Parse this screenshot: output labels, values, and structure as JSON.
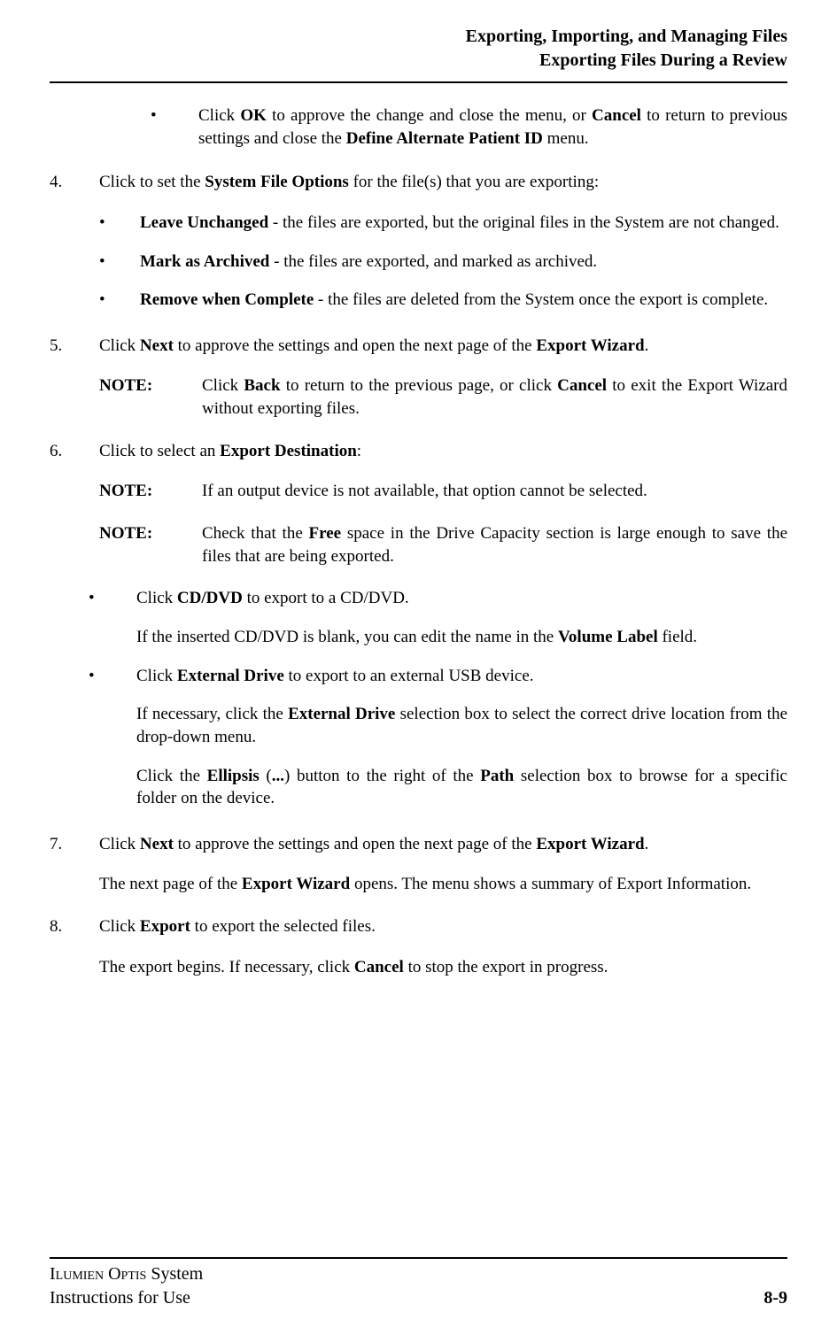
{
  "header": {
    "line1": "Exporting, Importing, and Managing Files",
    "line2": "Exporting Files During a Review"
  },
  "bullet1_pre": "Click ",
  "bullet1_b1": "OK",
  "bullet1_mid1": " to approve the change and close the menu, or ",
  "bullet1_b2": "Cancel",
  "bullet1_mid2": " to return to previous settings and close the ",
  "bullet1_b3": "Define Alternate Patient ID",
  "bullet1_post": " menu.",
  "step4_num": "4.",
  "step4_pre": "Click to set the ",
  "step4_b1": "System File Options",
  "step4_post": " for the file(s) that you are exporting:",
  "step4_opt1_b": "Leave Unchanged",
  "step4_opt1_t": " - the files are exported, but the original files in the System are not changed.",
  "step4_opt2_b": "Mark as Archived",
  "step4_opt2_t": " - the files are exported, and marked as archived.",
  "step4_opt3_b": "Remove when Complete",
  "step4_opt3_t": " - the files are deleted from the System once the export is complete.",
  "step5_num": "5.",
  "step5_pre": "Click ",
  "step5_b1": "Next",
  "step5_mid": " to approve the settings and open the next page of the ",
  "step5_b2": "Export Wizard",
  "step5_post": ".",
  "note_label": "NOTE:",
  "note1_pre": "Click ",
  "note1_b1": "Back",
  "note1_mid": " to return to the previous page, or click ",
  "note1_b2": "Cancel",
  "note1_post": " to exit the Export Wizard without exporting files.",
  "step6_num": "6.",
  "step6_pre": "Click to select an ",
  "step6_b1": "Export Destination",
  "step6_post": ":",
  "note2_text": "If an output device is not available, that option cannot be selected.",
  "note3_pre": "Check that the ",
  "note3_b1": "Free",
  "note3_post": " space in the Drive Capacity section is large enough to save the files that are being exported.",
  "step6_cd_pre": "Click ",
  "step6_cd_b": "CD/DVD",
  "step6_cd_post": " to export to a CD/DVD.",
  "step6_cd_sub_pre": "If the inserted CD/DVD is blank, you can edit the name in the ",
  "step6_cd_sub_b": "Volume Label",
  "step6_cd_sub_post": " field.",
  "step6_ext_pre": "Click ",
  "step6_ext_b": "External Drive",
  "step6_ext_post": " to export to an external USB device.",
  "step6_ext_sub1_pre": "If necessary, click the ",
  "step6_ext_sub1_b": "External Drive",
  "step6_ext_sub1_post": " selection box to select the correct drive location from the drop-down menu.",
  "step6_ext_sub2_pre": "Click the ",
  "step6_ext_sub2_b1": "Ellipsis",
  "step6_ext_sub2_mid1": " (",
  "step6_ext_sub2_b2": "...",
  "step6_ext_sub2_mid2": ") button to the right of the ",
  "step6_ext_sub2_b3": "Path",
  "step6_ext_sub2_post": " selection box to browse for a specific folder on the device.",
  "step7_num": "7.",
  "step7_pre": "Click ",
  "step7_b1": "Next",
  "step7_mid": " to approve the settings and open the next page of the ",
  "step7_b2": "Export Wizard",
  "step7_post": ".",
  "step7_body_pre": "The next page of the ",
  "step7_body_b": "Export Wizard",
  "step7_body_post": " opens. The menu shows a summary of Export Information.",
  "step8_num": "8.",
  "step8_pre": "Click ",
  "step8_b1": "Export",
  "step8_post": " to export the selected files.",
  "step8_body_pre": "The export begins.  If necessary, click ",
  "step8_body_b": "Cancel",
  "step8_body_post": " to stop the export in progress.",
  "footer": {
    "product_sc1": "Ilumien",
    "product_sc2": "Optis",
    "product_rest": " System",
    "line2": "Instructions for Use",
    "page": "8-9"
  },
  "bullet_char": "•"
}
